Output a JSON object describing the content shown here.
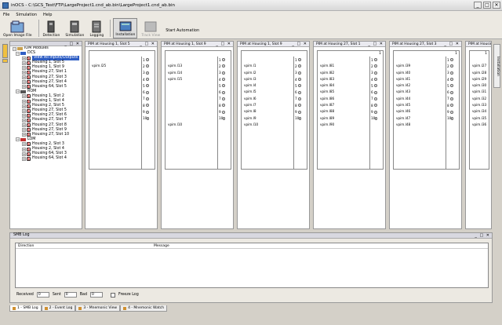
{
  "window": {
    "title": "inOCS - C:\\GCS_Test\\FTP\\LargeProject1.cnd_ab.bin\\LargeProject1.cnd_ab.bin",
    "controls": [
      "_",
      "□",
      "✕"
    ]
  },
  "menu": [
    "File",
    "Simulation",
    "Help"
  ],
  "toolbar": {
    "buttons": [
      {
        "label": "Open Image File",
        "icon": "open-image-icon"
      },
      {
        "label": "Detection",
        "icon": "detection-icon"
      },
      {
        "label": "Simulation",
        "icon": "simulation-icon"
      },
      {
        "label": "Logging",
        "icon": "logging-icon"
      },
      {
        "label": "Installation",
        "icon": "installation-icon",
        "active": true
      },
      {
        "label": "Track View",
        "icon": "track-view-icon",
        "disabled": true
      }
    ],
    "start_automation": "Start Automation"
  },
  "right_tab": "Installation",
  "tree": {
    "root": "IOM Modules",
    "groups": [
      {
        "name": "DCS",
        "items": [
          "View All Inputs/Outputs",
          "Housing 1, Slot 5",
          "Housing 1, Slot 9",
          "Housing 27, Slot 1",
          "Housing 27, Slot 3",
          "Housing 27, Slot 4",
          "Housing 64, Slot 5"
        ],
        "selected": 0
      },
      {
        "name": "ROM",
        "items": [
          "Housing 1, Slot 2",
          "Housing 1, Slot 4",
          "Housing 2, Slot 5",
          "Housing 27, Slot 5",
          "Housing 27, Slot 6",
          "Housing 27, Slot 7",
          "Housing 27, Slot 8",
          "Housing 27, Slot 9",
          "Housing 27, Slot 10"
        ]
      },
      {
        "name": "LOM",
        "items": [
          "Housing 2, Slot 3",
          "Housing 2, Slot 4",
          "Housing 64, Slot 3",
          "Housing 64, Slot 4"
        ]
      }
    ]
  },
  "pim_windows": [
    {
      "title": "PIM at Housing 1, Slot 5",
      "labels": [
        "",
        "vpim.l25",
        "",
        "",
        "",
        "",
        "",
        "",
        "",
        "",
        ""
      ],
      "pins": [
        "1",
        "2",
        "3",
        "4",
        "5",
        "6",
        "7",
        "8",
        "9",
        "10"
      ]
    },
    {
      "title": "PIM at Housing 1, Slot 9",
      "labels": [
        "",
        "vpim.l13",
        "vpim.l14",
        "vpim.l15",
        "",
        "",
        "",
        "",
        "",
        "",
        "vpim.l10"
      ],
      "pins": [
        "1",
        "2",
        "3",
        "4",
        "5",
        "6",
        "7",
        "8",
        "9",
        "10"
      ]
    },
    {
      "title": "PIM at Housing 1, Slot 9",
      "labels": [
        "",
        "vpim.l1",
        "vpim.l2",
        "vpim.l3",
        "vpim.l4",
        "vpim.l5",
        "vpim.l6",
        "vpim.l7",
        "vpim.l8",
        "vpim.l9",
        "vpim.l10"
      ],
      "pins": [
        "1",
        "2",
        "3",
        "4",
        "5",
        "6",
        "7",
        "8",
        "9",
        "10"
      ]
    },
    {
      "title": "PIM at Housing 27, Slot 1",
      "labels": [
        "",
        "vpim.l81",
        "vpim.l82",
        "vpim.l83",
        "vpim.l84",
        "vpim.l85",
        "vpim.l86",
        "vpim.l87",
        "vpim.l88",
        "vpim.l89",
        "vpim.l90"
      ],
      "pins": [
        "1",
        "2",
        "3",
        "4",
        "5",
        "6",
        "7",
        "8",
        "9",
        "10"
      ],
      "top": "1"
    },
    {
      "title": "PIM at Housing 27, Slot 3",
      "labels": [
        "",
        "vpim.l39",
        "vpim.l40",
        "vpim.l41",
        "vpim.l42",
        "vpim.l43",
        "vpim.l44",
        "vpim.l45",
        "vpim.l46",
        "vpim.l47",
        "vpim.l48"
      ],
      "pins": [
        "1",
        "2",
        "3",
        "4",
        "5",
        "6",
        "7",
        "8",
        "9",
        "10"
      ],
      "top": "1"
    },
    {
      "title": "PIM at Housing 27",
      "labels": [
        "",
        "vpim.l27",
        "vpim.l28",
        "vpim.l29",
        "vpim.l30",
        "vpim.l31",
        "vpim.l32",
        "vpim.l33",
        "vpim.l34",
        "vpim.l35",
        "vpim.l36"
      ],
      "pins": [],
      "top": "1"
    }
  ],
  "smb_log": {
    "title": "SMB Log",
    "columns": [
      "Direction",
      "Message"
    ],
    "received_label": "Received",
    "received": "0",
    "sent_label": "Sent",
    "sent": "0",
    "bad_label": "Bad",
    "bad": "0",
    "freeze_label": "Freeze Log"
  },
  "bottom_tabs": [
    "1 - SMB Log",
    "2 - Event Log",
    "3 - Mnemonic View",
    "4 - Mnemonic Watch"
  ]
}
